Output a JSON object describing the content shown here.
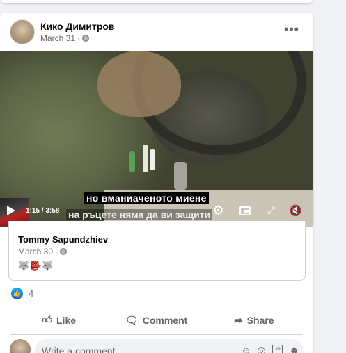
{
  "post": {
    "author": "Кико Димитров",
    "date": "March 31",
    "date_sep": "·",
    "more_label": "•••"
  },
  "video": {
    "caption_line1": "но вманиаченото миене",
    "caption_line2": "на ръцете  няма да ви защити",
    "time": "1:15 / 3:58",
    "progress": 0.22
  },
  "shared": {
    "author": "Tommy Sapundzhiev",
    "date": "March 30",
    "date_sep": "·",
    "emojis": "🐺👺🐺"
  },
  "reactions": {
    "count": "4"
  },
  "actions": {
    "like": "Like",
    "comment": "Comment",
    "share": "Share"
  },
  "comment_box": {
    "placeholder": "Write a comment..."
  },
  "colors": {
    "accent": "#2d88ff",
    "text_secondary": "#65676b"
  }
}
